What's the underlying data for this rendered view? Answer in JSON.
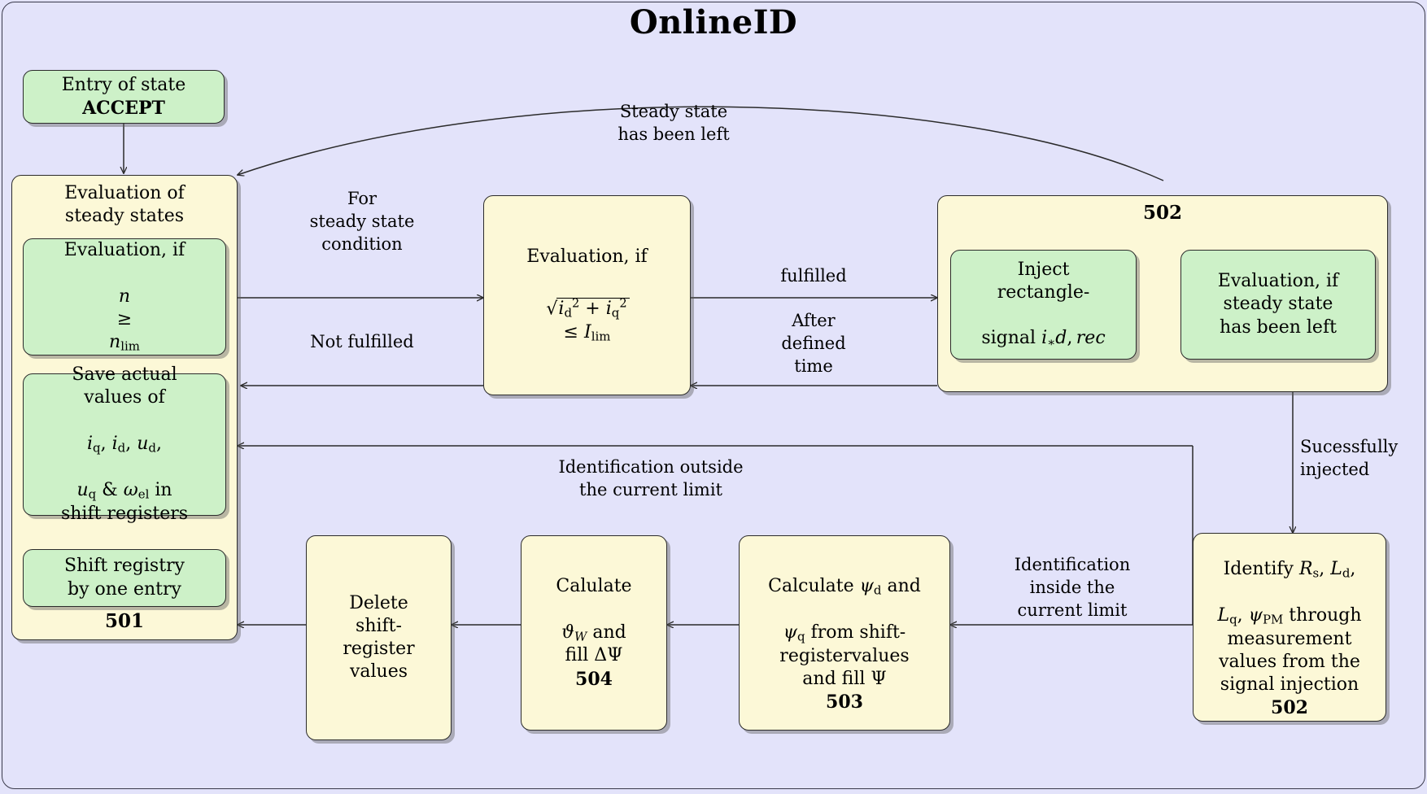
{
  "title": "OnlineID",
  "colors": {
    "background": "#e3e3fa",
    "cream_box": "#fcf8d7",
    "green_box": "#cdf1c8",
    "border": "#2b2b2b"
  },
  "groups": {
    "group_501": {
      "number": "501",
      "header": "Evaluation of\nsteady states"
    },
    "group_502": {
      "number": "502"
    }
  },
  "nodes": {
    "entry": {
      "label": "Entry of state",
      "bold_label": "ACCEPT"
    },
    "eval_speed": {
      "line1": "Evaluation, if",
      "line2_var": "n",
      "line2_rel": "≥",
      "line2_lim_var": "n",
      "line2_lim_sub": "lim"
    },
    "save_values": {
      "line1": "Save actual",
      "line2": "values of",
      "line3": "i_q, i_d, u_d,",
      "line4": "u_q & ω_el in",
      "line5": "shift registers"
    },
    "shift_registry": {
      "line1": "Shift registry",
      "line2": "by one entry"
    },
    "eval_current": {
      "line1": "Evaluation, if",
      "formula": "√(i_d² + i_q²) ≤ I_lim"
    },
    "inject": {
      "line1": "Inject",
      "line2": "rectangle-",
      "line3": "signal i∗d, rec"
    },
    "eval_steady_left": {
      "line1": "Evaluation, if",
      "line2": "steady state",
      "line3": "has been left"
    },
    "identify": {
      "line1": "Identify R_s, L_d,",
      "line2": "L_q, ψ_PM through",
      "line3": "measurement",
      "line4": "values from the",
      "line5": "signal injection",
      "number": "502"
    },
    "calc_psi": {
      "line1": "Calculate ψ_d and",
      "line2": "ψ_q from shift-",
      "line3": "registervalues",
      "line4": "and fill Ψ",
      "number": "503"
    },
    "calc_theta": {
      "line1": "Calulate",
      "line2": "ϑ_W and",
      "line3": "fill ΔΨ",
      "number": "504"
    },
    "delete_shift": {
      "line1": "Delete",
      "line2": "shift-",
      "line3": "register",
      "line4": "values"
    }
  },
  "edge_labels": {
    "steady_state_left": "Steady state\nhas been left",
    "for_steady_state_condition": "For\nsteady state\ncondition",
    "not_fulfilled": "Not fulfilled",
    "fulfilled": "fulfilled",
    "after_defined_time": "After\ndefined\ntime",
    "successfully_injected": "Sucessfully\ninjected",
    "identification_outside": "Identification outside\nthe current limit",
    "identification_inside": "Identification\ninside the\ncurrent limit"
  }
}
